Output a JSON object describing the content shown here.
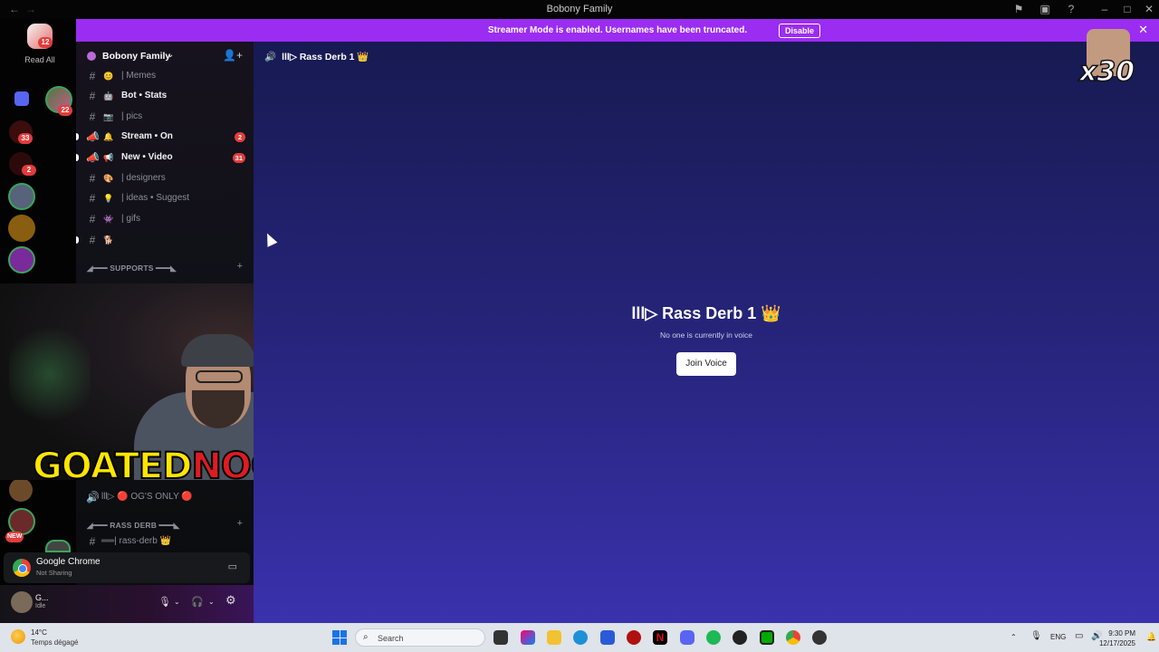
{
  "window": {
    "title": "Bobony Family"
  },
  "banner": {
    "message": "Streamer Mode is enabled. Usernames have been truncated.",
    "disable_label": "Disable"
  },
  "rail": {
    "read_all_label": "Read All",
    "read_all_badge": "12",
    "servers": [
      {
        "badge": "22"
      },
      {
        "badge": "33"
      },
      {
        "badge": "2"
      },
      {
        "badge": ""
      },
      {
        "badge": ""
      },
      {
        "badge": ""
      }
    ],
    "new_label": "NEW"
  },
  "server": {
    "name": "Bobony Family"
  },
  "channels": [
    {
      "label": "| Memes",
      "emoji": "😊",
      "bold": false,
      "count": ""
    },
    {
      "label": "Bot • Stats",
      "emoji": "🤖",
      "bold": true,
      "count": ""
    },
    {
      "label": "| pics",
      "emoji": "📷",
      "bold": false,
      "count": ""
    },
    {
      "label": "Stream • On",
      "emoji": "🔔",
      "bold": true,
      "count": "2"
    },
    {
      "label": "New • Video",
      "emoji": "📢",
      "bold": true,
      "count": "31"
    },
    {
      "label": "| designers",
      "emoji": "🎨",
      "bold": false,
      "count": ""
    },
    {
      "label": "| ideas • Suggest",
      "emoji": "💡",
      "bold": false,
      "count": ""
    },
    {
      "label": "| gifs",
      "emoji": "👾",
      "bold": false,
      "count": ""
    },
    {
      "label": "",
      "emoji": "🐕",
      "bold": false,
      "count": ""
    }
  ],
  "categories": {
    "supports": "◢━━━ SUPPORTS ━━━◣",
    "rass_derb": "◢━━━ RASS DERB ━━━◣"
  },
  "lower_channels": {
    "ogs": "lll▷ 🔴 OG'S ONLY 🔴",
    "rass": "══| rass-derb 👑"
  },
  "webcam": {
    "logo_a": "GOATED",
    "logo_b": "NOOBIE"
  },
  "screen_share": {
    "app": "Google Chrome",
    "status": "Not Sharing"
  },
  "user": {
    "name": "G...",
    "status": "Idle"
  },
  "main": {
    "channel_title": "lll▷ Rass Derb 1 👑",
    "voice_title": "lll▷ Rass Derb 1 👑",
    "voice_subtitle": "No one is currently in voice",
    "join_label": "Join Voice"
  },
  "overlay": {
    "multiplier": "x30"
  },
  "taskbar": {
    "temperature": "14°C",
    "condition": "Temps dégagé",
    "search_placeholder": "Search",
    "language": "ENG",
    "time": "9:30 PM",
    "date": "12/17/2025"
  }
}
